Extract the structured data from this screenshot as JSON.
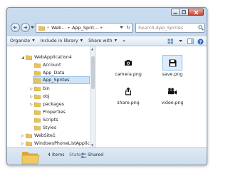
{
  "address_bar": {
    "crumbs": [
      "Web...",
      "App_Sprit..."
    ]
  },
  "search": {
    "placeholder": "Search App_Sprites"
  },
  "toolbar": {
    "organize": "Organize",
    "include_in_library": "Include in library",
    "share_with": "Share with",
    "more": "»"
  },
  "nav_tree": {
    "items": [
      {
        "label": "WebApplication4",
        "expander": "◢"
      },
      {
        "label": "Account",
        "expander": ""
      },
      {
        "label": "App_Data",
        "expander": ""
      },
      {
        "label": "App_Sprites",
        "expander": "",
        "selected": true
      },
      {
        "label": "bin",
        "expander": "▷"
      },
      {
        "label": "obj",
        "expander": "▷"
      },
      {
        "label": "packages",
        "expander": "▷"
      },
      {
        "label": "Properties",
        "expander": ""
      },
      {
        "label": "Scripts",
        "expander": ""
      },
      {
        "label": "Styles",
        "expander": ""
      },
      {
        "label": "WebSite1",
        "expander": "▷"
      },
      {
        "label": "WindowsPhoneListApplic",
        "expander": "▷"
      }
    ]
  },
  "files": [
    {
      "name": "camera.png",
      "icon": "camera-icon"
    },
    {
      "name": "save.png",
      "icon": "floppy-disk-icon",
      "selected": true
    },
    {
      "name": "share.png",
      "icon": "share-icon"
    },
    {
      "name": "video.png",
      "icon": "video-camera-icon"
    }
  ],
  "status_bar": {
    "count": "4 items",
    "state_label": "State:",
    "state_value": "Shared"
  },
  "colors": {
    "frame": "#b3cbe4",
    "folder": "#e8c25a",
    "selection": "#cde4f7",
    "close_button": "#c7463a"
  }
}
